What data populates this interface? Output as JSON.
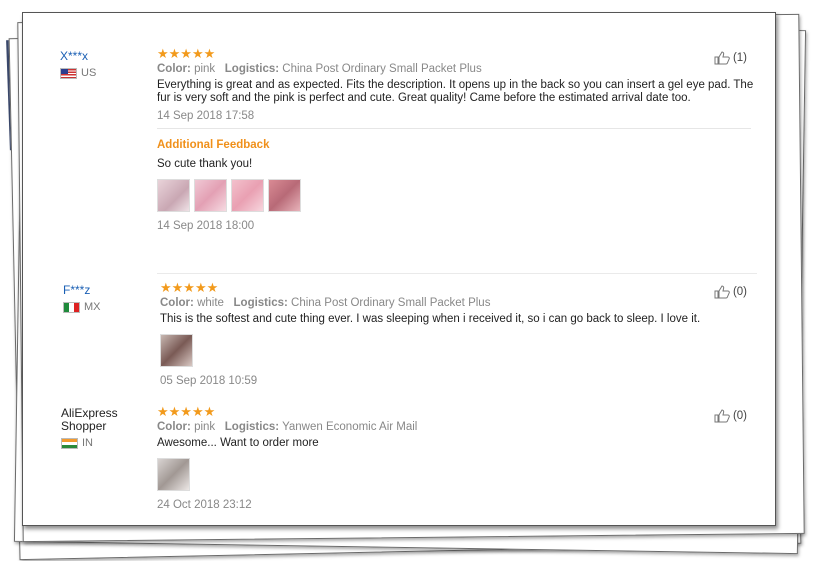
{
  "reviews": [
    {
      "user": "X***x",
      "country": "US",
      "stars": "★★★★★",
      "color_label": "Color:",
      "color": "pink",
      "logistics_label": "Logistics:",
      "logistics": "China Post Ordinary Small Packet Plus",
      "text": "Everything is great and as expected. Fits the description. It opens up in the back so you can insert a gel eye pad. The fur is very soft and the pink is perfect and cute. Great quality! Came before the estimated arrival date too.",
      "date": "14 Sep 2018 17:58",
      "helpful": "(1)",
      "additional_title": "Additional Feedback",
      "additional_text": "So cute thank you!",
      "additional_date": "14 Sep 2018 18:00"
    },
    {
      "user": "F***z",
      "country": "MX",
      "stars": "★★★★★",
      "color_label": "Color:",
      "color": "white",
      "logistics_label": "Logistics:",
      "logistics": "China Post Ordinary Small Packet Plus",
      "text": "This is the softest and cute thing ever. I was sleeping when i received it, so i can go back to sleep. I love it.",
      "date": "05 Sep 2018 10:59",
      "helpful": "(0)"
    },
    {
      "user": "AliExpress Shopper",
      "country": "IN",
      "stars": "★★★★★",
      "color_label": "Color:",
      "color": "pink",
      "logistics_label": "Logistics:",
      "logistics": "Yanwen Economic Air Mail",
      "text": "Awesome... Want to order more",
      "date": "24 Oct 2018 23:12",
      "helpful": "(0)"
    }
  ],
  "colors": {
    "stars": "#f29a1c",
    "additional": "#f0901a",
    "username": "#1a5fb4"
  },
  "icons": {
    "helpful": "thumbs-up-icon"
  }
}
